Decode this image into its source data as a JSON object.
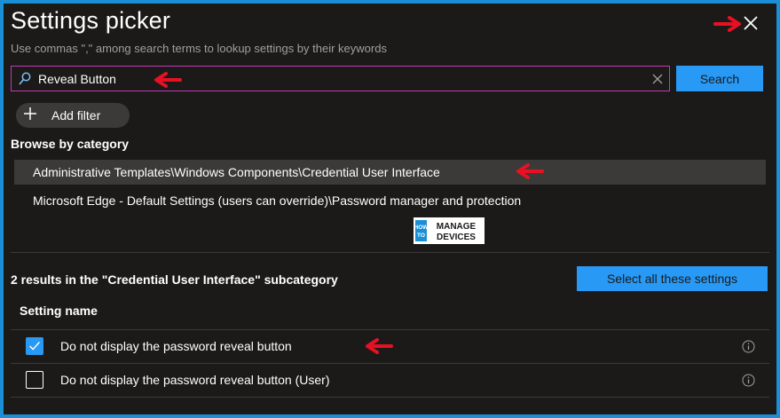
{
  "dialog": {
    "title": "Settings picker",
    "subtitle": "Use commas \",\" among search terms to lookup settings by their keywords"
  },
  "search": {
    "value": "Reveal Button",
    "button_label": "Search"
  },
  "filter": {
    "add_label": "Add filter"
  },
  "browse": {
    "heading": "Browse by category",
    "categories": [
      {
        "label": "Administrative Templates\\Windows Components\\Credential User Interface",
        "selected": true
      },
      {
        "label": "Microsoft Edge - Default Settings (users can override)\\Password manager and protection",
        "selected": false
      }
    ]
  },
  "logo": {
    "line1": "HOW",
    "line2": "TO",
    "word1": "MANAGE",
    "word2": "DEVICES"
  },
  "results": {
    "summary": "2 results in the \"Credential User Interface\" subcategory",
    "select_all_label": "Select all these settings",
    "column_header": "Setting name",
    "rows": [
      {
        "label": "Do not display the password reveal button",
        "checked": true
      },
      {
        "label": "Do not display the password reveal button (User)",
        "checked": false
      }
    ]
  },
  "icons": {
    "close": "close-icon",
    "search": "search-icon",
    "clear": "clear-icon",
    "add": "plus-icon",
    "info": "info-icon"
  },
  "colors": {
    "background": "#1b1a19",
    "border": "#1a8fd6",
    "accent": "#2899f5",
    "search_focus": "#c239b3",
    "selected_row": "#3b3a39",
    "annotation_arrow": "#e81123"
  }
}
